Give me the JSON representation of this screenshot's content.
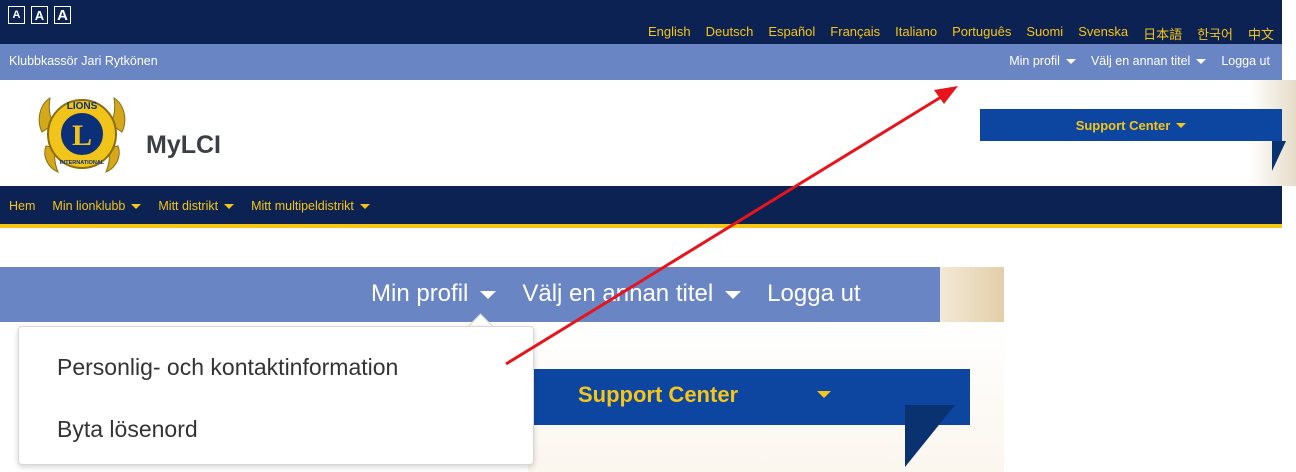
{
  "font_size_buttons": [
    "A",
    "A",
    "A"
  ],
  "languages": [
    "English",
    "Deutsch",
    "Español",
    "Français",
    "Italiano",
    "Português",
    "Suomi",
    "Svenska",
    "日本語",
    "한국어",
    "中文"
  ],
  "userbar": {
    "user_title": "Klubbkassör Jari Rytkönen",
    "min_profil": "Min profil",
    "valj_titel": "Välj en annan titel",
    "logga_ut": "Logga ut"
  },
  "header": {
    "brand": "MyLCI",
    "logo_text_top": "LIONS",
    "logo_letter": "L",
    "logo_text_bottom": "INTERNATIONAL",
    "support_center": "Support Center"
  },
  "main_nav": [
    "Hem",
    "Min lionklubb",
    "Mitt distrikt",
    "Mitt multipeldistrikt"
  ],
  "zoom": {
    "min_profil": "Min profil",
    "valj_titel": "Välj en annan titel",
    "logga_ut": "Logga ut",
    "support_center": "Support Center",
    "dropdown_items": [
      "Personlig- och kontaktinformation",
      "Byta lösenord"
    ]
  },
  "colors": {
    "navy": "#0c2252",
    "user_bar": "#6a85c4",
    "accent_yellow": "#f5c518",
    "support_blue": "#0d46a0",
    "annotation_arrow": "#e8141b"
  }
}
